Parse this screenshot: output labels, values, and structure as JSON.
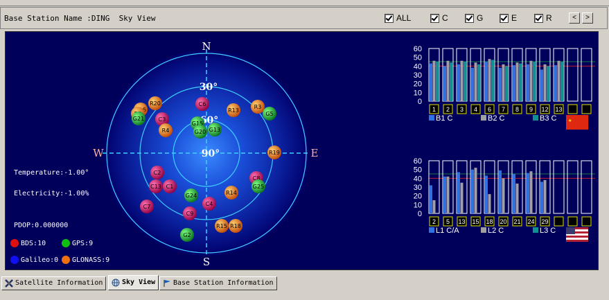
{
  "toolbar": {
    "station_label": "Base Station Name :DING  Sky View",
    "filters": [
      {
        "label": "ALL",
        "checked": true
      },
      {
        "label": "C",
        "checked": true
      },
      {
        "label": "G",
        "checked": true
      },
      {
        "label": "E",
        "checked": true
      },
      {
        "label": "R",
        "checked": true
      }
    ],
    "prev_label": "<",
    "next_label": ">"
  },
  "skyview": {
    "directions": {
      "north": "N",
      "south": "S",
      "east": "E",
      "west": "W"
    },
    "elevations": [
      "30°",
      "60°",
      "90°"
    ],
    "satellites": [
      {
        "id": "R20",
        "system": "R"
      },
      {
        "id": "R16",
        "system": "R"
      },
      {
        "id": "R5",
        "system": "R"
      },
      {
        "id": "G21",
        "system": "G"
      },
      {
        "id": "C3",
        "system": "C"
      },
      {
        "id": "R4",
        "system": "R"
      },
      {
        "id": "C6",
        "system": "C"
      },
      {
        "id": "G15",
        "system": "G"
      },
      {
        "id": "G20",
        "system": "G"
      },
      {
        "id": "G13",
        "system": "G"
      },
      {
        "id": "R13",
        "system": "R"
      },
      {
        "id": "R3",
        "system": "R"
      },
      {
        "id": "G5",
        "system": "G"
      },
      {
        "id": "R19",
        "system": "R"
      },
      {
        "id": "C2",
        "system": "C"
      },
      {
        "id": "C13",
        "system": "C"
      },
      {
        "id": "C1",
        "system": "C"
      },
      {
        "id": "G24",
        "system": "G"
      },
      {
        "id": "C4",
        "system": "C"
      },
      {
        "id": "R14",
        "system": "R"
      },
      {
        "id": "C8",
        "system": "C"
      },
      {
        "id": "G25",
        "system": "G"
      },
      {
        "id": "C9",
        "system": "C"
      },
      {
        "id": "C7",
        "system": "C"
      },
      {
        "id": "R15",
        "system": "R"
      },
      {
        "id": "R18",
        "system": "R"
      },
      {
        "id": "G2",
        "system": "G"
      }
    ],
    "temperature": "Temperature:-1.00°",
    "electricity": "Electricity:-1.00%",
    "pdop": "PDOP:0.000000",
    "counts": [
      {
        "label": "BDS:10",
        "color": "#e01010"
      },
      {
        "label": "GPS:9",
        "color": "#10c010"
      },
      {
        "label": "Galileo:0",
        "color": "#1010f0"
      },
      {
        "label": "GLONASS:9",
        "color": "#f07010"
      }
    ],
    "system_colors": {
      "C": "#c0105a",
      "G": "#10a030",
      "R": "#e07010"
    }
  },
  "chart_data": [
    {
      "type": "bar",
      "constellation": "BDS",
      "yticks": [
        0,
        10,
        20,
        30,
        40,
        50,
        60
      ],
      "ylim": [
        0,
        60
      ],
      "categories": [
        "1",
        "2",
        "3",
        "4",
        "6",
        "7",
        "8",
        "9",
        "12",
        "13",
        "",
        ""
      ],
      "series": [
        {
          "name": "B1 C",
          "color": "#3070e0",
          "values": [
            43,
            40,
            42,
            38,
            45,
            38,
            41,
            42,
            36,
            41,
            0,
            0
          ]
        },
        {
          "name": "B2 C",
          "color": "#a0a0a0",
          "values": [
            46,
            46,
            46,
            44,
            48,
            42,
            44,
            46,
            42,
            46,
            0,
            0
          ]
        },
        {
          "name": "B3 C",
          "color": "#109090",
          "values": [
            45,
            44,
            45,
            42,
            47,
            40,
            43,
            45,
            40,
            45,
            0,
            0
          ]
        }
      ],
      "flag": "china-flag"
    },
    {
      "type": "bar",
      "constellation": "GPS",
      "yticks": [
        0,
        10,
        20,
        30,
        40,
        50,
        60
      ],
      "ylim": [
        0,
        60
      ],
      "categories": [
        "2",
        "5",
        "13",
        "15",
        "18",
        "20",
        "21",
        "24",
        "29",
        "",
        "",
        ""
      ],
      "series": [
        {
          "name": "L1 C/A",
          "color": "#3070e0",
          "values": [
            32,
            42,
            47,
            50,
            43,
            49,
            45,
            46,
            36,
            0,
            0,
            0
          ]
        },
        {
          "name": "L2 C",
          "color": "#a0a0a0",
          "values": [
            15,
            42,
            35,
            52,
            22,
            40,
            34,
            48,
            38,
            0,
            0,
            0
          ]
        },
        {
          "name": "L3 C",
          "color": "#109090",
          "values": [
            0,
            0,
            0,
            0,
            0,
            0,
            0,
            0,
            0,
            0,
            0,
            0
          ]
        }
      ],
      "flag": "usa-flag"
    }
  ],
  "tabs": [
    {
      "label": "Satellite Information",
      "icon": "satellite-icon",
      "active": false
    },
    {
      "label": "Sky View",
      "icon": "globe-icon",
      "active": true
    },
    {
      "label": "Base Station Information",
      "icon": "flag-icon",
      "active": false
    }
  ]
}
